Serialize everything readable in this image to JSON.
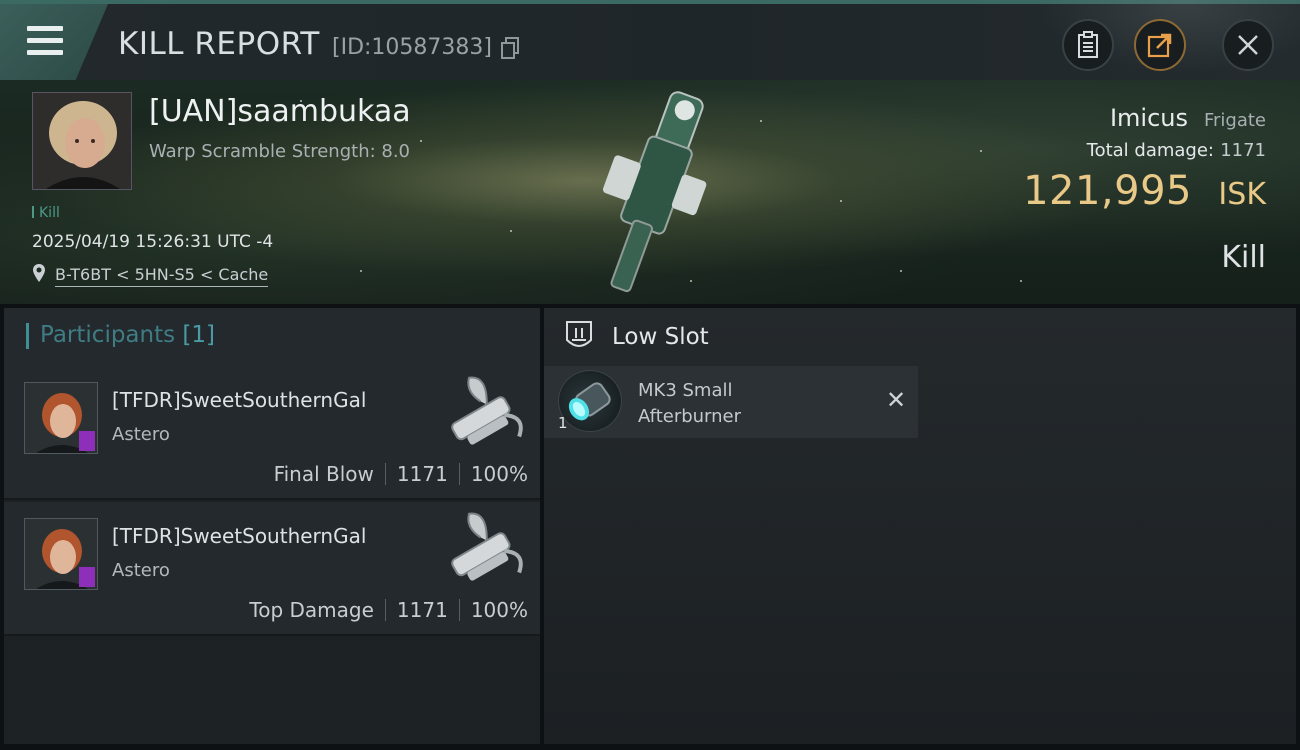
{
  "header": {
    "title": "KILL REPORT",
    "report_id": "[ID:10587383]",
    "menu_icon": "hamburger-menu-icon",
    "buttons": [
      "clipboard-icon",
      "share-icon",
      "close-icon"
    ]
  },
  "victim": {
    "name": "[UAN]saambukaa",
    "warp_scramble": "Warp Scramble Strength: 8.0",
    "kill_tag": "Kill",
    "datetime": "2025/04/19 15:26:31 UTC -4",
    "location": "B-T6BT < 5HN-S5 < Cache",
    "ship_name": "Imicus",
    "ship_class": "Frigate",
    "total_damage_label": "Total damage:",
    "total_damage_value": "1171",
    "isk_value": "121,995",
    "isk_unit": "ISK",
    "result": "Kill"
  },
  "participants": {
    "title": "Participants",
    "count": "[1]",
    "rows": [
      {
        "name": "[TFDR]SweetSouthernGal",
        "ship": "Astero",
        "role": "Final Blow",
        "damage": "1171",
        "percent": "100%"
      },
      {
        "name": "[TFDR]SweetSouthernGal",
        "ship": "Astero",
        "role": "Top Damage",
        "damage": "1171",
        "percent": "100%"
      }
    ]
  },
  "slots": {
    "title": "Low Slot",
    "modules": [
      {
        "qty": "1",
        "name_line1": "MK3 Small",
        "name_line2": "Afterburner",
        "status": "✕"
      }
    ]
  },
  "colors": {
    "accent_teal": "#3b6a62",
    "isk_gold": "#e9c987",
    "participants_teal": "#3f7c84",
    "badge_purple": "#8d2fb8"
  }
}
